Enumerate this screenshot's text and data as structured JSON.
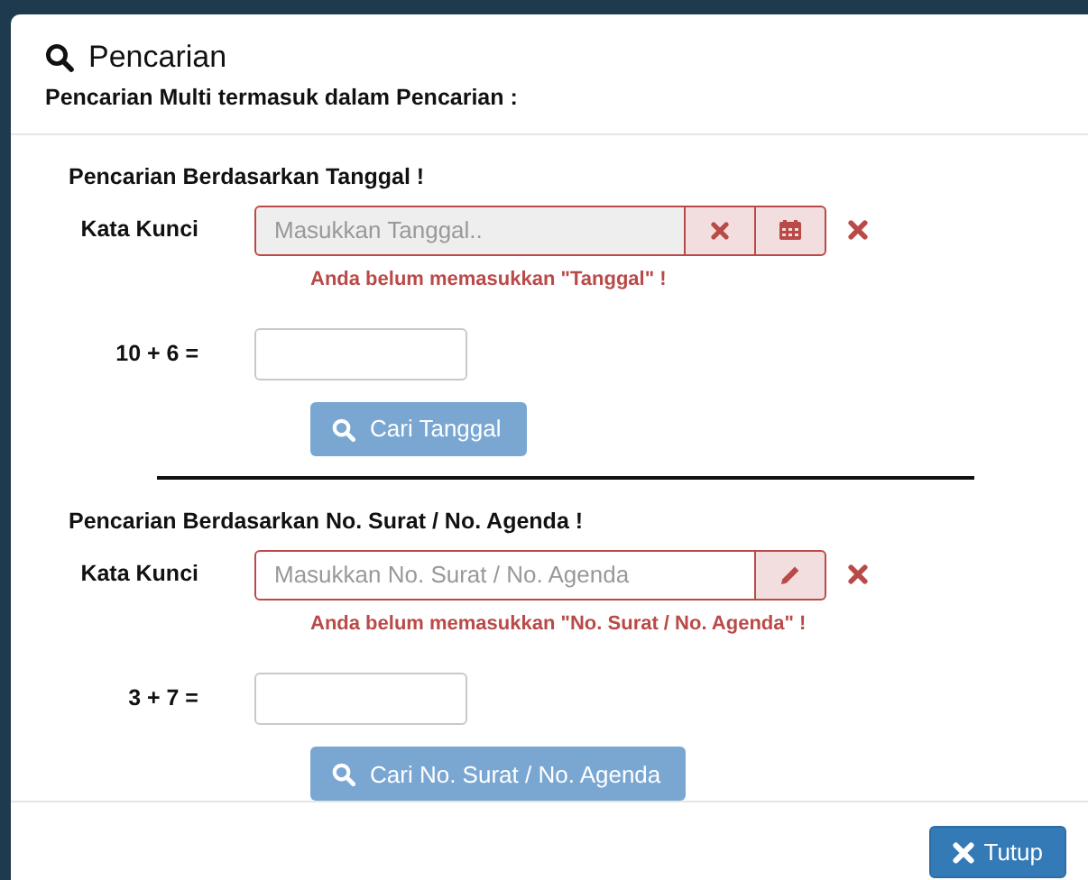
{
  "modal": {
    "title": "Pencarian",
    "subtitle": "Pencarian Multi termasuk dalam Pencarian :"
  },
  "sections": [
    {
      "heading": "Pencarian Berdasarkan Tanggal !",
      "label": "Kata Kunci",
      "field": {
        "placeholder": "Masukkan Tanggal..",
        "disabled": true,
        "invalid": true
      },
      "addons": [
        {
          "kind": "clear"
        },
        {
          "kind": "calendar"
        }
      ],
      "error": "Anda belum memasukkan \"Tanggal\" !",
      "captcha": "10 + 6 =",
      "button": "Cari Tanggal"
    },
    {
      "heading": "Pencarian Berdasarkan No. Surat / No. Agenda !",
      "label": "Kata Kunci",
      "field": {
        "placeholder": "Masukkan No. Surat / No. Agenda",
        "disabled": false,
        "invalid": true
      },
      "addons": [
        {
          "kind": "edit"
        }
      ],
      "error": "Anda belum memasukkan \"No. Surat / No. Agenda\" !",
      "captcha": "3 + 7 =",
      "button": "Cari No. Surat / No. Agenda"
    }
  ],
  "footer": {
    "button": "Tutup"
  }
}
